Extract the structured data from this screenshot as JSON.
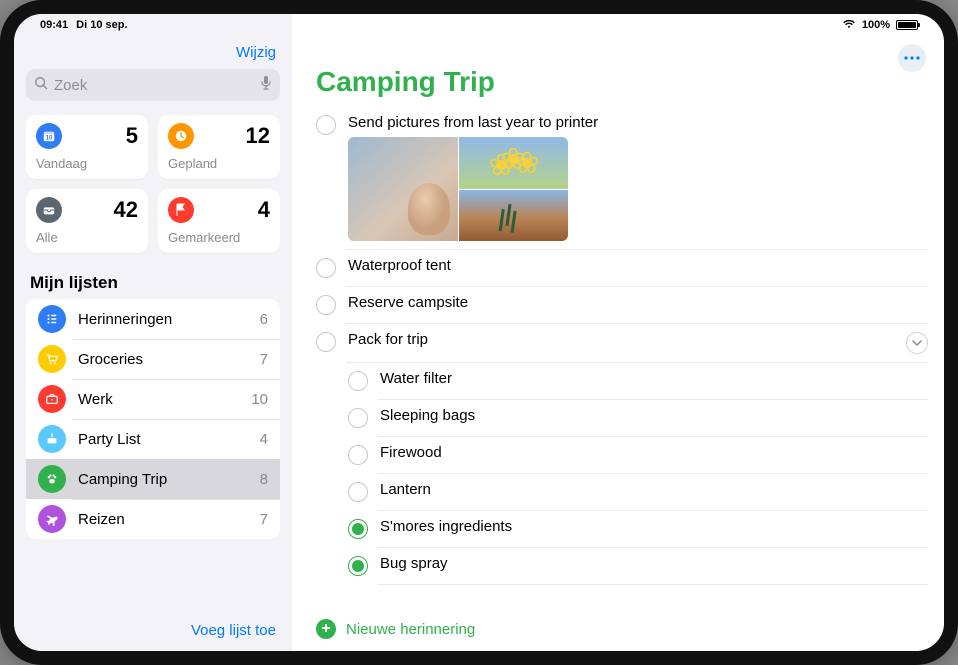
{
  "status": {
    "time": "09:41",
    "date": "Di 10 sep.",
    "battery_pct": "100%"
  },
  "sidebar": {
    "edit_label": "Wijzig",
    "search_placeholder": "Zoek",
    "cards": [
      {
        "id": "vandaag",
        "label": "Vandaag",
        "count": "5",
        "icon": "calendar-icon",
        "color": "#2e7cf6"
      },
      {
        "id": "gepland",
        "label": "Gepland",
        "count": "12",
        "icon": "clock-icon",
        "color": "#ff9500"
      },
      {
        "id": "alle",
        "label": "Alle",
        "count": "42",
        "icon": "inbox-icon",
        "color": "#5b6770"
      },
      {
        "id": "gemarkeerd",
        "label": "Gemarkeerd",
        "count": "4",
        "icon": "flag-icon",
        "color": "#ff3b30"
      }
    ],
    "section_title": "Mijn lijsten",
    "lists": [
      {
        "id": "herinneringen",
        "name": "Herinneringen",
        "count": "6",
        "icon": "list-icon",
        "color": "#2e7cf6"
      },
      {
        "id": "groceries",
        "name": "Groceries",
        "count": "7",
        "icon": "cart-icon",
        "color": "#ffcc00"
      },
      {
        "id": "werk",
        "name": "Werk",
        "count": "10",
        "icon": "briefcase-icon",
        "color": "#ff3b30"
      },
      {
        "id": "party",
        "name": "Party List",
        "count": "4",
        "icon": "cake-icon",
        "color": "#5ac8fa"
      },
      {
        "id": "camping",
        "name": "Camping Trip",
        "count": "8",
        "icon": "paw-icon",
        "color": "#30b14d",
        "selected": true
      },
      {
        "id": "reizen",
        "name": "Reizen",
        "count": "7",
        "icon": "plane-icon",
        "color": "#af52de"
      }
    ],
    "add_list_label": "Voeg lijst toe"
  },
  "main": {
    "title": "Camping Trip",
    "accent": "#30b14d",
    "reminders": [
      {
        "id": "r1",
        "title": "Send pictures from last year to printer",
        "completed": false,
        "has_images": true
      },
      {
        "id": "r2",
        "title": "Waterproof tent",
        "completed": false
      },
      {
        "id": "r3",
        "title": "Reserve campsite",
        "completed": false
      },
      {
        "id": "r4",
        "title": "Pack for trip",
        "completed": false,
        "expandable": true
      }
    ],
    "subtasks": [
      {
        "id": "s1",
        "title": "Water filter",
        "completed": false
      },
      {
        "id": "s2",
        "title": "Sleeping bags",
        "completed": false
      },
      {
        "id": "s3",
        "title": "Firewood",
        "completed": false
      },
      {
        "id": "s4",
        "title": "Lantern",
        "completed": false
      },
      {
        "id": "s5",
        "title": "S'mores ingredients",
        "completed": true
      },
      {
        "id": "s6",
        "title": "Bug spray",
        "completed": true
      }
    ],
    "new_reminder_label": "Nieuwe herinnering"
  }
}
